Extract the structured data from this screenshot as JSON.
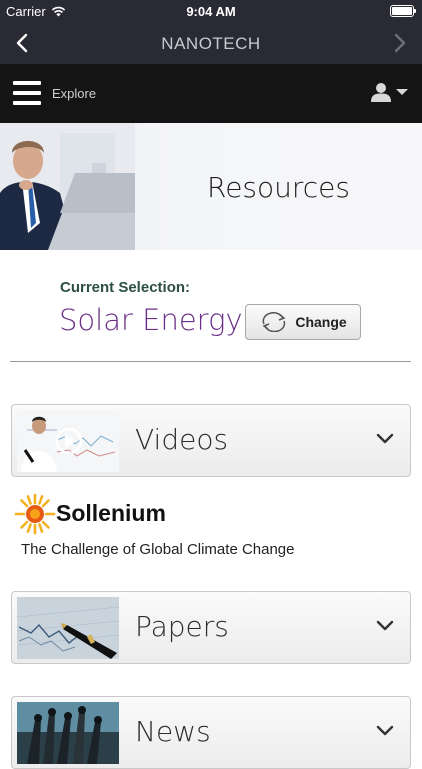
{
  "status_bar": {
    "carrier": "Carrier",
    "time": "9:04 AM"
  },
  "nav": {
    "title": "NANOTECH"
  },
  "explore_bar": {
    "label": "Explore"
  },
  "hero": {
    "title": "Resources"
  },
  "selection": {
    "label": "Current Selection:",
    "value": "Solar Energy",
    "change_label": "Change"
  },
  "sections": [
    {
      "label": "Videos"
    },
    {
      "label": "Papers"
    },
    {
      "label": "News"
    }
  ],
  "sponsor": {
    "name": "Sollenium",
    "tagline": "The Challenge of Global Climate Change"
  },
  "colors": {
    "bar": "#2a2a34",
    "explore_bg": "#141414",
    "selection_label": "#2d5040",
    "selection_value": "#6a2f88"
  },
  "icons": [
    "wifi-icon",
    "battery-icon",
    "back-chevron-icon",
    "forward-chevron-icon",
    "menu-icon",
    "user-icon",
    "refresh-icon",
    "play-icon",
    "chevron-down-icon",
    "sun-logo-icon"
  ]
}
